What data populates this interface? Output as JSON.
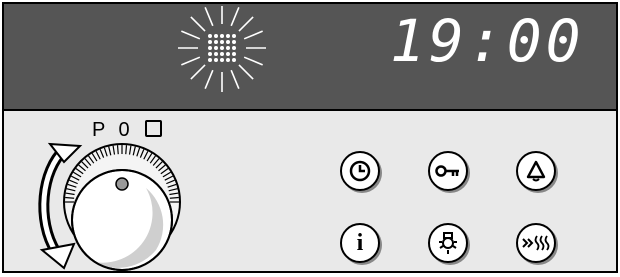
{
  "display": {
    "time": "19:00",
    "indicator": "blinking-dots-burst"
  },
  "selector_knob": {
    "position_labels": [
      "P",
      "0"
    ],
    "icons": [
      "square-position-icon",
      "rotate-arrows-icon"
    ]
  },
  "buttons": [
    {
      "id": "clock",
      "icon": "clock-icon"
    },
    {
      "id": "key",
      "icon": "key-icon"
    },
    {
      "id": "timer",
      "icon": "bell-icon"
    },
    {
      "id": "info",
      "icon": "info-icon"
    },
    {
      "id": "light",
      "icon": "lamp-icon"
    },
    {
      "id": "rapid-heat",
      "icon": "rapid-heat-icon"
    }
  ],
  "colors": {
    "display_background": "#555555",
    "panel_background": "#e9e9e9",
    "display_text": "#ffffff"
  }
}
